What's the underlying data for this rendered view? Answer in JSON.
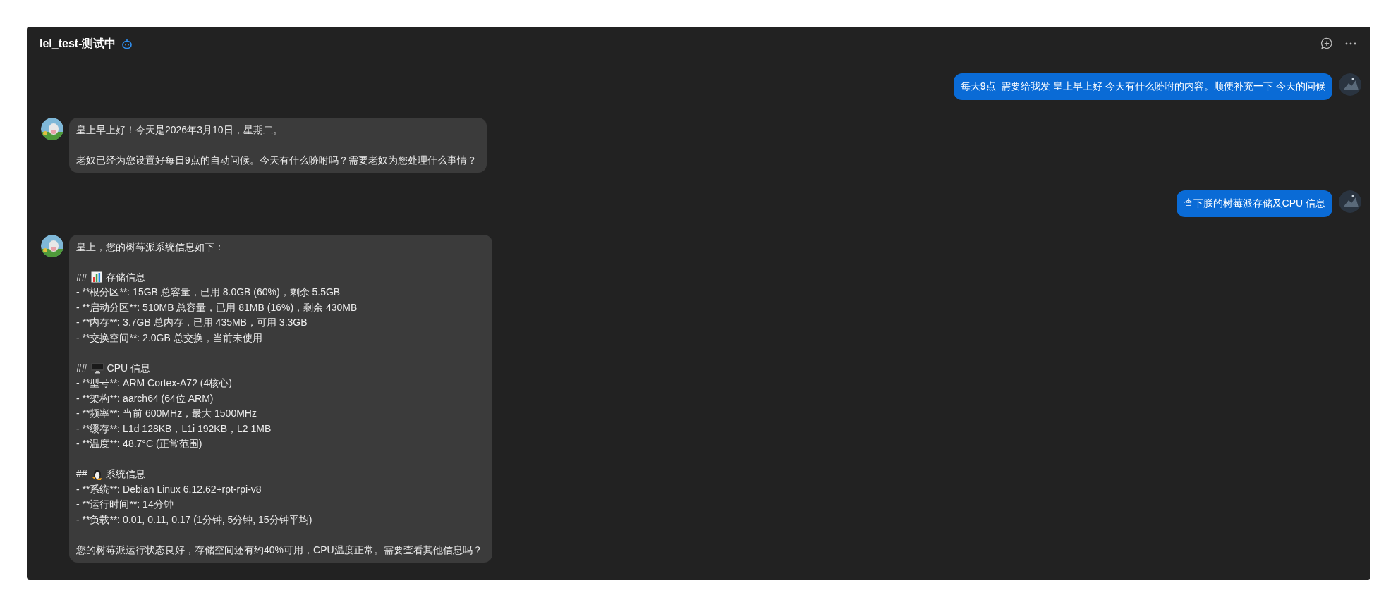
{
  "header": {
    "title": "lel_test-测试中"
  },
  "messages": [
    {
      "kind": "user",
      "lines": [
        {
          "kind": "text",
          "text": "每天9点  需要给我发 皇上早上好 今天有什么吩咐的内容。顺便补充一下 今天的问候"
        }
      ]
    },
    {
      "kind": "bot",
      "lines": [
        {
          "kind": "text",
          "text": "皇上早上好！今天是2026年3月10日，星期二。"
        },
        {
          "kind": "blank"
        },
        {
          "kind": "text",
          "text": "老奴已经为您设置好每日9点的自动问候。今天有什么吩咐吗？需要老奴为您处理什么事情？"
        }
      ]
    },
    {
      "kind": "user",
      "lines": [
        {
          "kind": "text",
          "text": "查下朕的树莓派存储及CPU 信息"
        }
      ]
    },
    {
      "kind": "bot",
      "lines": [
        {
          "kind": "text",
          "text": "皇上，您的树莓派系统信息如下："
        },
        {
          "kind": "blank"
        },
        {
          "kind": "heading",
          "prefix": "##",
          "text": "存储信息"
        },
        {
          "kind": "text",
          "text": "- **根分区**: 15GB 总容量，已用 8.0GB (60%)，剩余 5.5GB"
        },
        {
          "kind": "text",
          "text": "- **启动分区**: 510MB 总容量，已用 81MB (16%)，剩余 430MB"
        },
        {
          "kind": "text",
          "text": "- **内存**: 3.7GB 总内存，已用 435MB，可用 3.3GB"
        },
        {
          "kind": "text",
          "text": "- **交换空间**: 2.0GB 总交换，当前未使用"
        },
        {
          "kind": "blank"
        },
        {
          "kind": "heading",
          "prefix": "##",
          "text": "CPU 信息"
        },
        {
          "kind": "text",
          "text": "- **型号**: ARM Cortex-A72 (4核心)"
        },
        {
          "kind": "text",
          "text": "- **架构**: aarch64 (64位 ARM)"
        },
        {
          "kind": "text",
          "text": "- **频率**: 当前 600MHz，最大 1500MHz"
        },
        {
          "kind": "text",
          "text": "- **缓存**: L1d 128KB，L1i 192KB，L2 1MB"
        },
        {
          "kind": "text",
          "text": "- **温度**: 48.7°C (正常范围)"
        },
        {
          "kind": "blank"
        },
        {
          "kind": "heading",
          "prefix": "##",
          "text": "系统信息"
        },
        {
          "kind": "text",
          "text": "- **系统**: Debian Linux 6.12.62+rpt-rpi-v8"
        },
        {
          "kind": "text",
          "text": "- **运行时间**: 14分钟"
        },
        {
          "kind": "text",
          "text": "- **负载**: 0.01, 0.11, 0.17 (1分钟, 5分钟, 15分钟平均)"
        },
        {
          "kind": "blank"
        },
        {
          "kind": "text",
          "text": "您的树莓派运行状态良好，存储空间还有约40%可用，CPU温度正常。需要查看其他信息吗？"
        }
      ]
    }
  ]
}
